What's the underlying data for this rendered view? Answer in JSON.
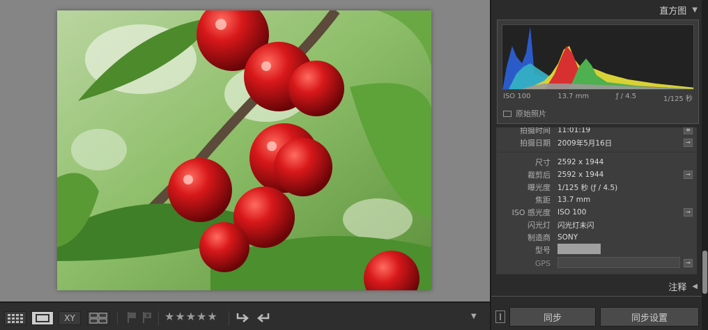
{
  "histogram": {
    "title": "直方图",
    "iso": "ISO 100",
    "focal": "13.7 mm",
    "aperture": "ƒ / 4.5",
    "shutter": "1/125 秒",
    "original_photo_label": "原始照片"
  },
  "metadata": {
    "rows": [
      {
        "label": "拍摄时间",
        "value": "11:01:19"
      },
      {
        "label": "拍摄日期",
        "value": "2009年5月16日"
      },
      {
        "label": "尺寸",
        "value": "2592 x 1944"
      },
      {
        "label": "裁剪后",
        "value": "2592 x 1944"
      },
      {
        "label": "曝光度",
        "value": "1/125 秒 (ƒ / 4.5)"
      },
      {
        "label": "焦距",
        "value": "13.7 mm"
      },
      {
        "label": "ISO 感光度",
        "value": "ISO 100"
      },
      {
        "label": "闪光灯",
        "value": "闪光灯未闪"
      },
      {
        "label": "制造商",
        "value": "SONY"
      },
      {
        "label": "型号",
        "value": ""
      },
      {
        "label": "GPS",
        "value": ""
      }
    ]
  },
  "notes": {
    "title": "注释"
  },
  "sync": {
    "sync_label": "同步",
    "sync_settings_label": "同步设置"
  },
  "toolbar": {
    "view_icons": [
      "grid-view-icon",
      "loupe-view-icon",
      "compare-view-icon",
      "survey-view-icon"
    ],
    "compare_label": "XY",
    "stars": "★★★★★"
  },
  "colors": {
    "panel": "#2b2b2b",
    "canvas": "#858585",
    "accent_red": "#d83a3a",
    "accent_green": "#4fb04f",
    "accent_blue": "#2e57c8"
  }
}
